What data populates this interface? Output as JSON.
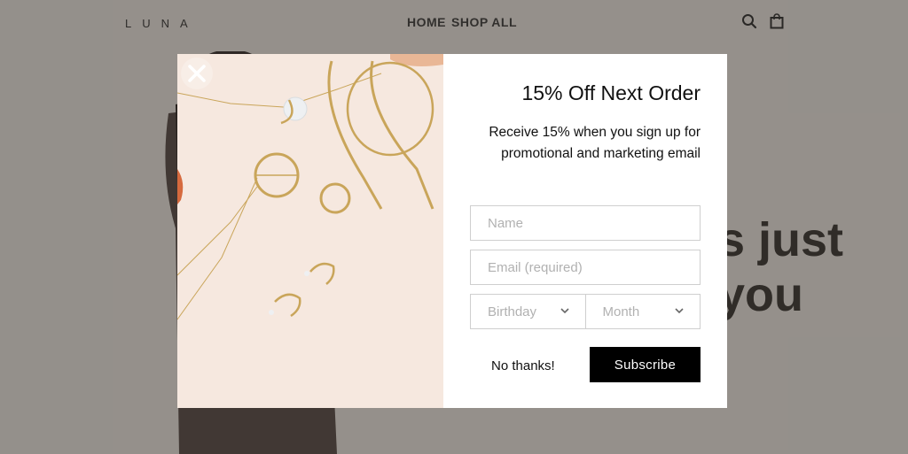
{
  "site": {
    "logo": "LUNA",
    "nav": [
      "HOME",
      "SHOP ALL"
    ],
    "hero_text": "s just\nyou"
  },
  "modal": {
    "title": "15% Off Next Order",
    "subtitle": "Receive 15% when you sign up for promotional and marketing email",
    "name_placeholder": "Name",
    "email_placeholder": "Email (required)",
    "birthday_label": "Birthday",
    "month_label": "Month",
    "decline_label": "No thanks!",
    "submit_label": "Subscribe"
  },
  "colors": {
    "backdrop": "#a29e99",
    "button_bg": "#000000",
    "image_bg": "#f5e6dc",
    "gold": "#c9a55a"
  },
  "icons": [
    "search-icon",
    "bag-icon",
    "close-icon",
    "chevron-down-icon"
  ]
}
